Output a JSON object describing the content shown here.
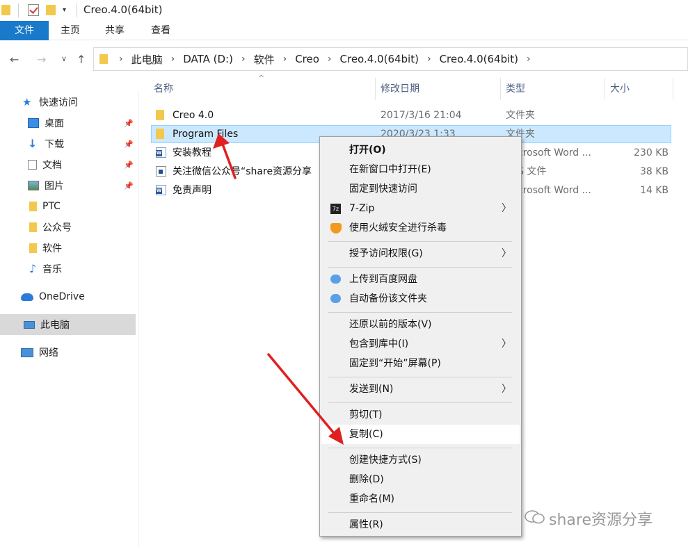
{
  "window": {
    "title": "Creo.4.0(64bit)"
  },
  "ribbon": {
    "tabs": [
      "文件",
      "主页",
      "共享",
      "查看"
    ]
  },
  "address": {
    "crumbs": [
      "此电脑",
      "DATA (D:)",
      "软件",
      "Creo",
      "Creo.4.0(64bit)",
      "Creo.4.0(64bit)"
    ]
  },
  "nav": {
    "quick_access": "快速访问",
    "items": [
      {
        "label": "桌面",
        "icon": "desktop-icon",
        "pinned": true
      },
      {
        "label": "下载",
        "icon": "download-icon",
        "pinned": true
      },
      {
        "label": "文档",
        "icon": "documents-icon",
        "pinned": true
      },
      {
        "label": "图片",
        "icon": "pictures-icon",
        "pinned": true
      },
      {
        "label": "PTC",
        "icon": "folder-icon",
        "pinned": false
      },
      {
        "label": "公众号",
        "icon": "folder-icon",
        "pinned": false
      },
      {
        "label": "软件",
        "icon": "folder-icon",
        "pinned": false
      },
      {
        "label": "音乐",
        "icon": "music-icon",
        "pinned": false
      }
    ],
    "onedrive": "OneDrive",
    "this_pc": "此电脑",
    "network": "网络"
  },
  "columns": {
    "name": "名称",
    "date": "修改日期",
    "type": "类型",
    "size": "大小"
  },
  "files": [
    {
      "name": "Creo 4.0",
      "date": "2017/3/16 21:04",
      "type": "文件夹",
      "size": "",
      "icon": "folder-icon"
    },
    {
      "name": "Program Files",
      "date": "2020/3/23 1:33",
      "type": "文件夹",
      "size": "",
      "icon": "folder-icon",
      "selected": true
    },
    {
      "name": "安装教程",
      "date": "",
      "type": "crosoft Word ...",
      "size": "230 KB",
      "icon": "word-icon"
    },
    {
      "name": "关注微信公众号“share资源分享",
      "date": "",
      "type": "S 文件",
      "size": "38 KB",
      "icon": "document-icon"
    },
    {
      "name": "免责声明",
      "date": "",
      "type": "crosoft Word ...",
      "size": "14 KB",
      "icon": "word-icon"
    }
  ],
  "context_menu": {
    "open": "打开(O)",
    "open_new_window": "在新窗口中打开(E)",
    "pin_quick_access": "固定到快速访问",
    "seven_zip": "7-Zip",
    "antivirus": "使用火绒安全进行杀毒",
    "grant_access": "授予访问权限(G)",
    "upload_baidu": "上传到百度网盘",
    "auto_backup": "自动备份该文件夹",
    "restore_versions": "还原以前的版本(V)",
    "include_library": "包含到库中(I)",
    "pin_start": "固定到“开始”屏幕(P)",
    "send_to": "发送到(N)",
    "cut": "剪切(T)",
    "copy": "复制(C)",
    "create_shortcut": "创建快捷方式(S)",
    "delete": "删除(D)",
    "rename": "重命名(M)",
    "properties": "属性(R)",
    "submenu_arrow": "〉"
  },
  "watermark": "share资源分享",
  "colors": {
    "accent": "#1979ca",
    "selection": "#cce8ff",
    "arrow": "#e02020"
  }
}
